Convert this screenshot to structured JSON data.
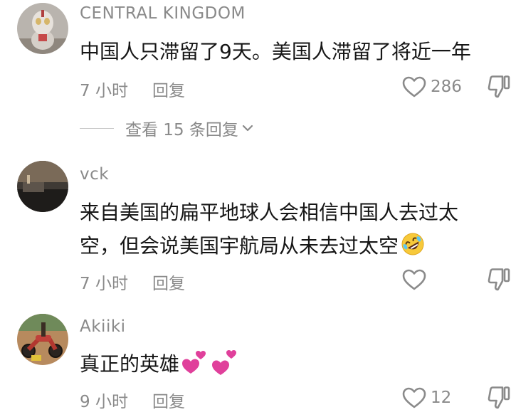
{
  "comments": [
    {
      "username": "CENTRAL KINGDOM",
      "lines": [
        "中国人只滞留了9天。美国人滞留了将近一年"
      ],
      "time": "7 小时",
      "reply_label": "回复",
      "like_count": "286",
      "avatar_icon": "figurine-avatar"
    },
    {
      "username": "vck",
      "lines": [
        "来自美国的扁平地球人会相信中国人去过太",
        "空，但会说美国宇航局从未去过太空"
      ],
      "emoji": "rolling-on-floor-laughing-emoji",
      "time": "7 小时",
      "reply_label": "回复",
      "like_count": "",
      "avatar_icon": "dark-room-avatar"
    },
    {
      "username": "Akiiki",
      "lines": [
        "真正的英雄"
      ],
      "emoji": "two-hearts-emoji",
      "time": "9 小时",
      "reply_label": "回复",
      "like_count": "12",
      "avatar_icon": "motorcycle-avatar"
    }
  ],
  "view_replies": {
    "label": "查看 15 条回复"
  },
  "colors": {
    "text": "#161616",
    "meta": "#8a8a8a",
    "icon": "#8a8a8a",
    "heart_emoji": "#e0409b"
  }
}
